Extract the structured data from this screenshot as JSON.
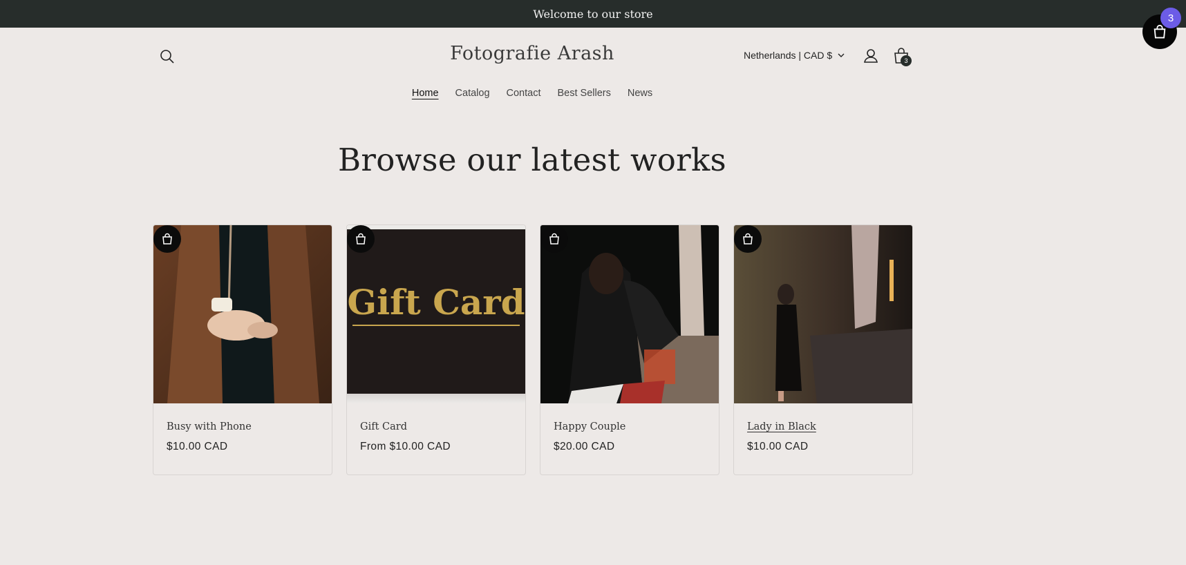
{
  "announcement": "Welcome to our store",
  "header": {
    "logo": "Fotografie Arash",
    "locale": "Netherlands | CAD $",
    "cart_count": "3"
  },
  "nav": [
    {
      "label": "Home",
      "active": true
    },
    {
      "label": "Catalog"
    },
    {
      "label": "Contact"
    },
    {
      "label": "Best Sellers"
    },
    {
      "label": "News"
    }
  ],
  "headline": "Browse our latest works",
  "products": [
    {
      "title": "Busy with Phone",
      "price": "$10.00 CAD"
    },
    {
      "title": "Gift Card",
      "price": "From $10.00 CAD",
      "image_text": "Gift Card"
    },
    {
      "title": "Happy Couple",
      "price": "$20.00 CAD"
    },
    {
      "title": "Lady in Black",
      "price": "$10.00 CAD"
    }
  ],
  "floating_cart": {
    "count": "3"
  },
  "colors": {
    "background": "#ede9e7",
    "announcement_bar": "#272d2b",
    "badge": "#6c5ce7"
  }
}
